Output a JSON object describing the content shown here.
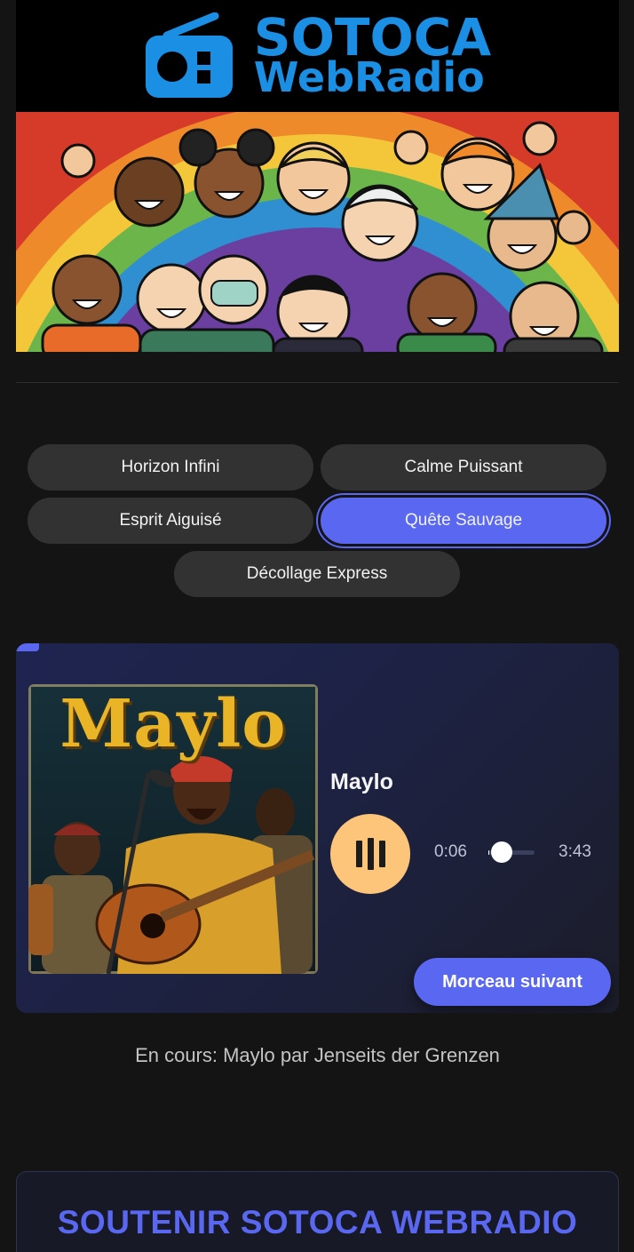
{
  "header": {
    "logo_line1": "SOTOCA",
    "logo_line2": "WebRadio"
  },
  "stations": [
    {
      "label": "Horizon Infini",
      "active": false
    },
    {
      "label": "Calme Puissant",
      "active": false
    },
    {
      "label": "Esprit Aiguisé",
      "active": false
    },
    {
      "label": "Quête Sauvage",
      "active": true
    },
    {
      "label": "Décollage Express",
      "active": false
    }
  ],
  "player": {
    "cover_title": "Maylo",
    "track_title": "Maylo",
    "current_time": "0:06",
    "total_time": "3:43",
    "progress_fraction": 0.027,
    "next_label": "Morceau suivant",
    "accent": "#5a67f0",
    "play_button_color": "#fdc57a"
  },
  "now_playing": "En cours: Maylo par Jenseits der Grenzen",
  "support": {
    "title": "SOUTENIR SOTOCA WEBRADIO"
  }
}
